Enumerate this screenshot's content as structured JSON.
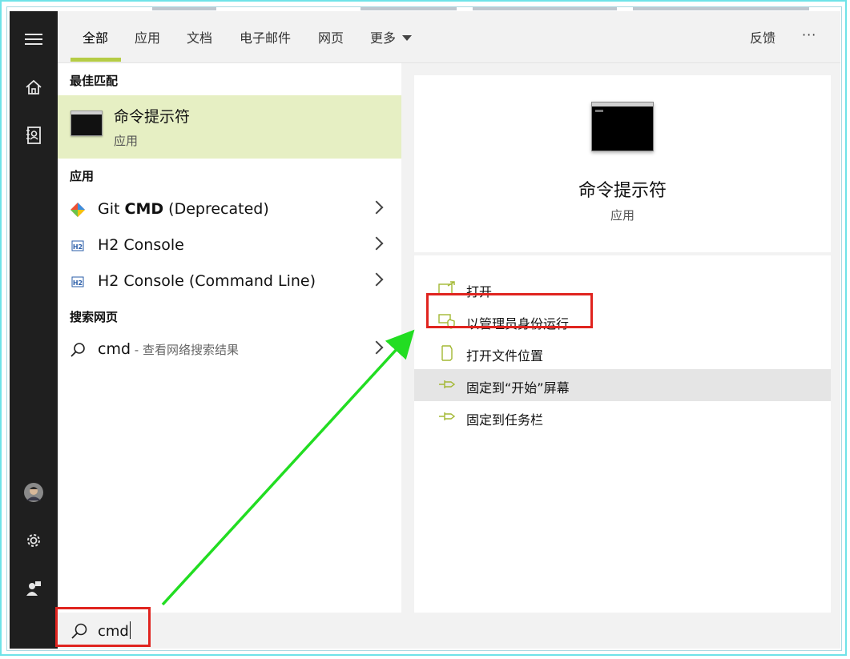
{
  "rail": {
    "items": [
      "menu-icon",
      "home-icon",
      "notebook-icon",
      "avatar",
      "gear-icon",
      "feedback-person-icon"
    ]
  },
  "tabs": {
    "items": [
      {
        "label": "全部",
        "active": true
      },
      {
        "label": "应用"
      },
      {
        "label": "文档"
      },
      {
        "label": "电子邮件"
      },
      {
        "label": "网页"
      },
      {
        "label": "更多"
      }
    ],
    "feedback_label": "反馈",
    "more_options_label": "···"
  },
  "left": {
    "best_match_heading": "最佳匹配",
    "best_match": {
      "title": "命令提示符",
      "subtitle": "应用"
    },
    "apps_heading": "应用",
    "apps": [
      {
        "label_plain": "Git ",
        "label_bold": "CMD",
        "label_rest": " (Deprecated)",
        "icon": "git-icon"
      },
      {
        "label_plain": "H2 Console",
        "label_bold": "",
        "label_rest": "",
        "icon": "h2-icon"
      },
      {
        "label_plain": "H2 Console (Command Line)",
        "label_bold": "",
        "label_rest": "",
        "icon": "h2-icon"
      }
    ],
    "web_heading": "搜索网页",
    "web_result": {
      "query": "cmd",
      "suffix": " - 查看网络搜索结果"
    }
  },
  "detail": {
    "title": "命令提示符",
    "subtitle": "应用",
    "actions": [
      {
        "label": "打开",
        "icon": "open-icon"
      },
      {
        "label": "以管理员身份运行",
        "icon": "shield-icon"
      },
      {
        "label": "打开文件位置",
        "icon": "folder-location-icon"
      },
      {
        "label": "固定到“开始”屏幕",
        "icon": "pin-icon",
        "highlighted": true
      },
      {
        "label": "固定到任务栏",
        "icon": "pin-icon"
      }
    ]
  },
  "search": {
    "value": "cmd"
  },
  "colors": {
    "accent": "#b5cc45",
    "annotation_red": "#e0241f",
    "annotation_arrow": "#22dd22"
  }
}
